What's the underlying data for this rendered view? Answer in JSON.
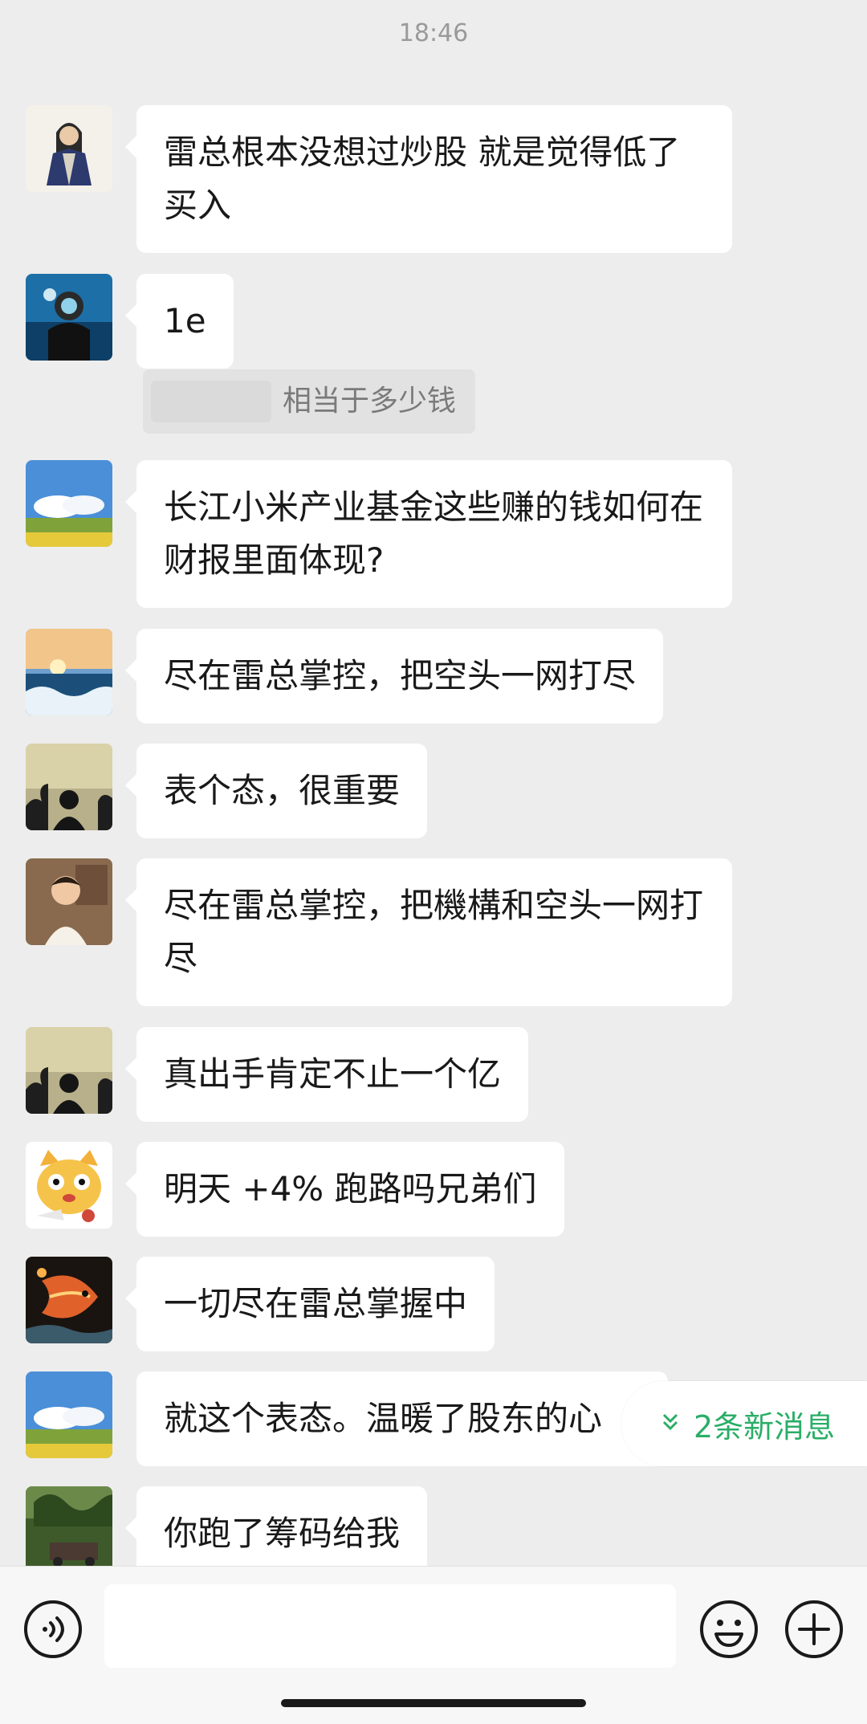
{
  "time_divider": "18:46",
  "messages": [
    {
      "text": "雷总根本没想过炒股 就是觉得低了买入"
    },
    {
      "text": "1e"
    },
    {
      "text": "长江小米产业基金这些赚的钱如何在财报里面体现?"
    },
    {
      "text": "尽在雷总掌控，把空头一网打尽"
    },
    {
      "text": "表个态，很重要"
    },
    {
      "text": "尽在雷总掌控，把機構和空头一网打尽"
    },
    {
      "text": "真出手肯定不止一个亿"
    },
    {
      "text": "明天 +4% 跑路吗兄弟们"
    },
    {
      "text": "一切尽在雷总掌握中"
    },
    {
      "text": "就这个表态。温暖了股东的心"
    },
    {
      "text": "你跑了筹码给我"
    }
  ],
  "quote": {
    "text": "相当于多少钱"
  },
  "new_messages": {
    "label": "2条新消息"
  },
  "bottom_bar": {
    "voice_icon": "voice-icon",
    "emoji_icon": "emoji-icon",
    "plus_icon": "plus-icon"
  }
}
